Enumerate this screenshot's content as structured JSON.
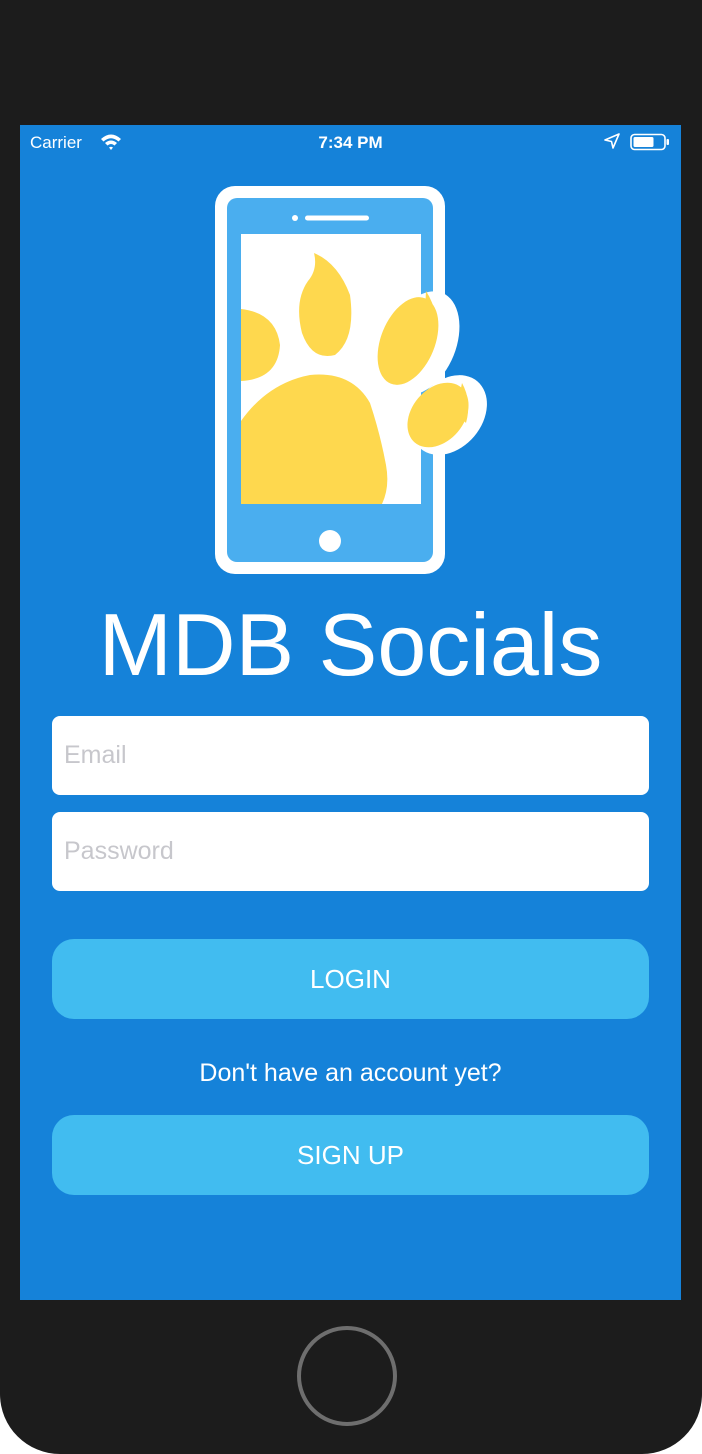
{
  "status_bar": {
    "carrier": "Carrier",
    "time": "7:34 PM",
    "icons": [
      "wifi-icon",
      "location-arrow-icon",
      "battery-icon"
    ]
  },
  "logo": {
    "icon": "phone-with-paw-logo",
    "colors": {
      "phone": "#ffffff",
      "screen_frame": "#4aaeef",
      "paw": "#fed84e"
    }
  },
  "app": {
    "title": "MDB Socials"
  },
  "form": {
    "email_placeholder": "Email",
    "email_value": "",
    "password_placeholder": "Password",
    "password_value": ""
  },
  "actions": {
    "login_label": "LOGIN",
    "no_account_prompt": "Don't have an account yet?",
    "signup_label": "SIGN UP"
  },
  "theme": {
    "background": "#1582d9",
    "button": "#41bcf0",
    "device_frame": "#1c1c1c"
  }
}
